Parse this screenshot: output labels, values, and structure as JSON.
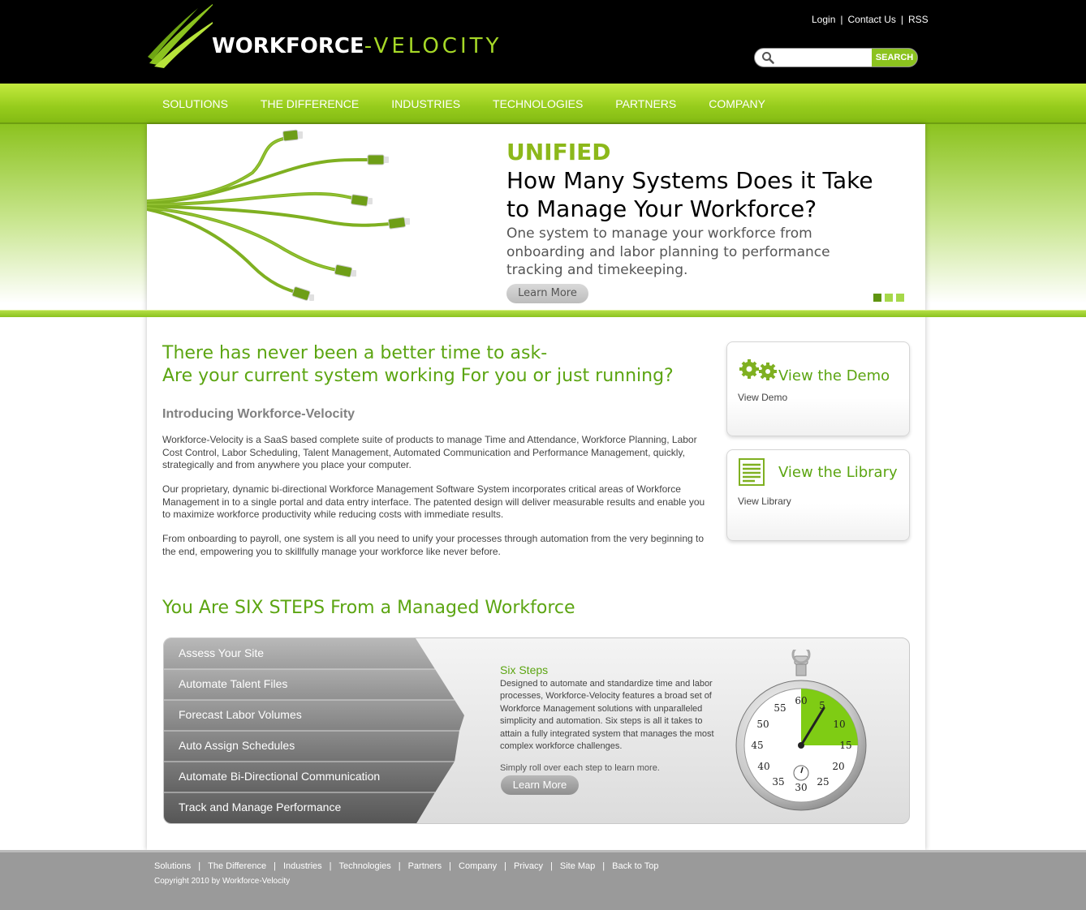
{
  "brand": {
    "name_part1": "WORKFORCE",
    "name_dash": "-",
    "name_part2": "VELOCITY"
  },
  "top_links": {
    "login": "Login",
    "contact": "Contact Us",
    "rss": "RSS"
  },
  "search": {
    "placeholder": "",
    "button": "SEARCH"
  },
  "nav": {
    "items": [
      "SOLUTIONS",
      "THE DIFFERENCE",
      "INDUSTRIES",
      "TECHNOLOGIES",
      "PARTNERS",
      "COMPANY"
    ]
  },
  "hero": {
    "kicker": "UNIFIED",
    "title": "How Many Systems Does it Take to Manage Your Workforce?",
    "subtitle": "One system to manage your workforce from onboarding and labor planning to performance tracking and timekeeping.",
    "button": "Learn More",
    "slides": 3,
    "active_slide": 1
  },
  "intro": {
    "headline_line1": "There has never been a better time to ask-",
    "headline_line2": "Are your current system working For you or just running?",
    "subheading": "Introducing Workforce-Velocity",
    "paragraphs": [
      "Workforce-Velocity is a SaaS based complete suite of products to manage Time and Attendance, Workforce Planning, Labor Cost Control, Labor Scheduling, Talent Management, Automated Communication and Performance Management, quickly, strategically and from anywhere you place your computer.",
      "Our proprietary, dynamic bi-directional Workforce Management Software System incorporates critical areas of Workforce Management in to a single portal and data entry interface. The patented design will deliver measurable results and enable you to maximize workforce productivity while reducing costs with immediate results.",
      "From onboarding to payroll, one system is all you need to unify your processes through automation from the very beginning to the end, empowering you to skillfully manage your workforce like never before."
    ]
  },
  "sidebar": {
    "demo": {
      "title": "View the Demo",
      "link": "View Demo"
    },
    "library": {
      "title": "View the Library",
      "link": "View Library"
    }
  },
  "steps": {
    "heading": "You Are SIX STEPS From a Managed Workforce",
    "items": [
      "Assess Your Site",
      "Automate Talent Files",
      "Forecast Labor Volumes",
      "Auto Assign Schedules",
      "Automate Bi-Directional Communication",
      "Track and Manage Performance"
    ],
    "title": "Six Steps",
    "description": "Designed to automate and standardize time and labor processes, Workforce-Velocity features a broad set of Workforce Management solutions with unparalleled simplicity and automation. Six steps is all it takes to attain a fully integrated system that manages the most complex workforce challenges.",
    "roll_text": "Simply roll over each step to learn more.",
    "button": "Learn More",
    "stopwatch_numbers": [
      "60",
      "5",
      "10",
      "15",
      "20",
      "25",
      "30",
      "35",
      "40",
      "45",
      "50",
      "55"
    ]
  },
  "footer": {
    "links": [
      "Solutions",
      "The Difference",
      "Industries",
      "Technologies",
      "Partners",
      "Company",
      "Privacy",
      "Site Map",
      "Back to Top"
    ],
    "copyright": "Copyright 2010 by Workforce-Velocity"
  },
  "colors": {
    "brand_green": "#8cc31f",
    "heading_green": "#5ca512",
    "header_black": "#000000",
    "footer_gray": "#9a9a9a"
  }
}
